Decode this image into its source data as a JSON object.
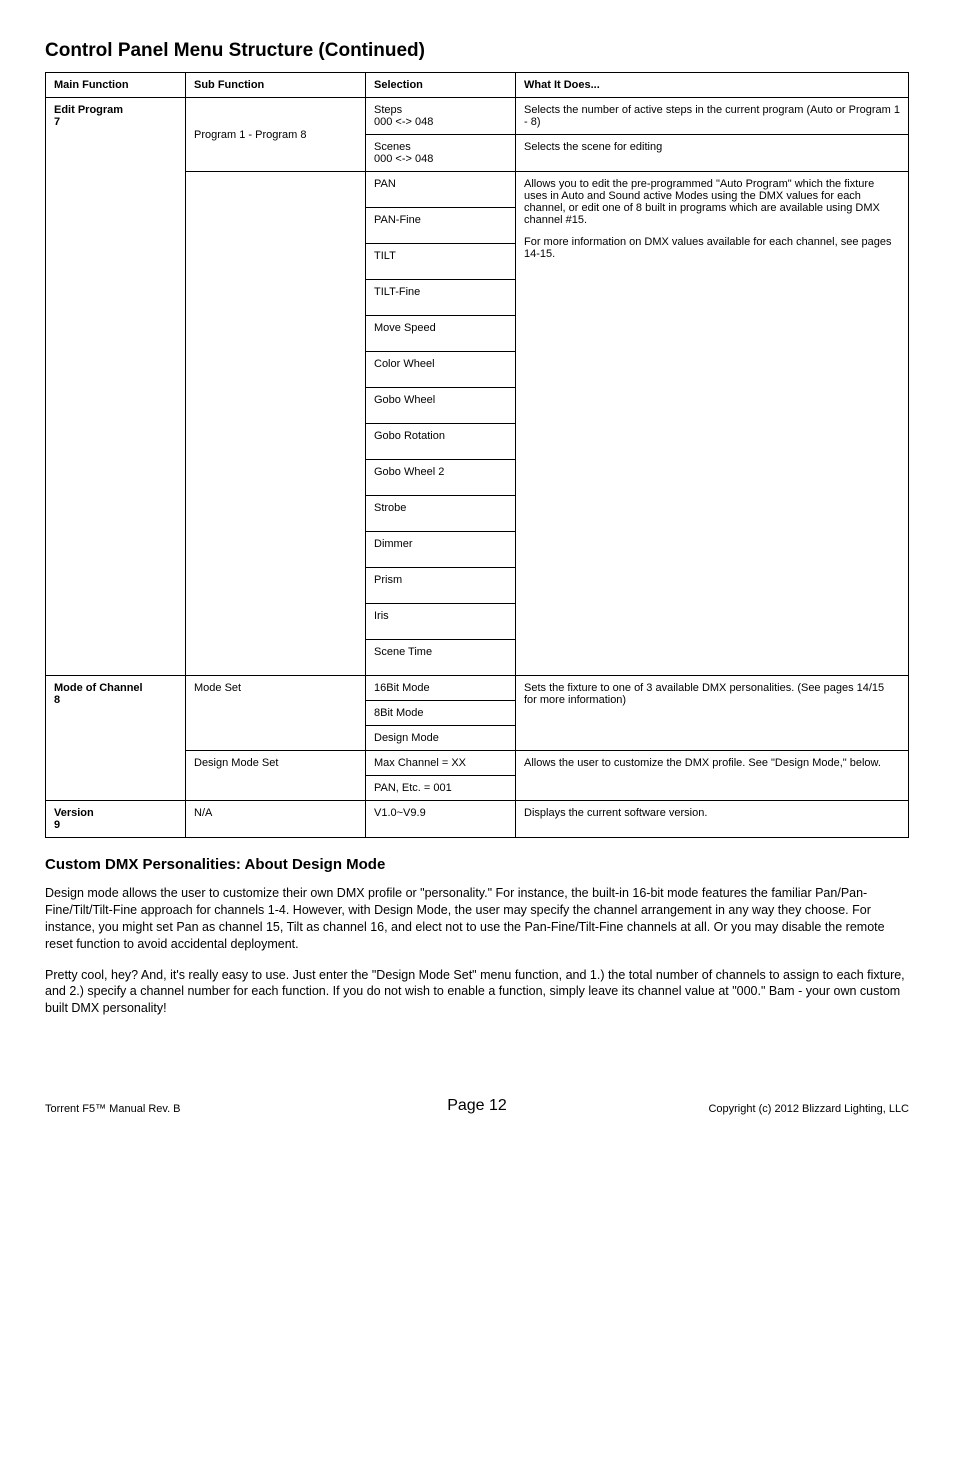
{
  "title": "Control Panel Menu Structure (Continued)",
  "table": {
    "headers": {
      "main": "Main Function",
      "sub": "Sub Function",
      "sel": "Selection",
      "what": "What It Does..."
    },
    "edit_program": {
      "label_l1": "Edit Program",
      "label_l2": "7",
      "sub": "Program 1 - Program 8",
      "steps_sel": "Steps\n000 <-> 048",
      "steps_what": "Selects the number of active steps in the current program (Auto or Program 1 - 8)",
      "scenes_sel": "Scenes\n000 <-> 048",
      "scenes_what": "Selects the scene for editing",
      "params": {
        "pan": "PAN",
        "panfine": "PAN-Fine",
        "tilt": "TILT",
        "tiltfine": "TILT-Fine",
        "move": "Move Speed",
        "color": "Color Wheel",
        "gobo": "Gobo Wheel",
        "goborot": "Gobo Rotation",
        "gobo2": "Gobo Wheel 2",
        "strobe": "Strobe",
        "dimmer": "Dimmer",
        "prism": "Prism",
        "iris": "Iris",
        "scenetime": "Scene Time"
      },
      "params_what_p1": "Allows you to edit the pre-programmed \"Auto Program\" which the fixture uses in Auto and Sound active Modes using the DMX values for each channel, or edit one of 8 built in programs which are available using DMX channel #15.",
      "params_what_p2": "For more information on DMX values available for each channel, see pages 14-15."
    },
    "mode_channel": {
      "label_l1": "Mode of Channel",
      "label_l2": "8",
      "modeset_sub": "Mode Set",
      "sel_16": "16Bit Mode",
      "sel_8": "8Bit Mode",
      "sel_design": "Design Mode",
      "modeset_what": "Sets the fixture to one of 3 available DMX personalities.  (See pages 14/15 for more information)",
      "designset_sub": "Design Mode Set",
      "sel_max": "Max Channel = XX",
      "sel_pan": "PAN, Etc. = 001",
      "designset_what": "Allows the user to customize the DMX profile. See \"Design Mode,\" below."
    },
    "version": {
      "label_l1": "Version",
      "label_l2": "9",
      "sub": "N/A",
      "sel": "V1.0~V9.9",
      "what": "Displays the current software version."
    }
  },
  "custom_dmx": {
    "heading": "Custom DMX Personalities: About Design Mode",
    "p1": "Design mode allows the user to customize their own DMX profile or \"personality.\"  For instance, the built-in 16-bit mode features the familiar Pan/Pan-Fine/Tilt/Tilt-Fine approach for channels 1-4.  However, with Design Mode, the user may specify the channel arrangement in any way they choose.  For instance, you might set Pan as channel 15, Tilt as channel 16, and elect not to use the Pan-Fine/Tilt-Fine channels at all.  Or you may disable the remote reset function to avoid accidental deployment.",
    "p2": "Pretty cool, hey?  And, it's really easy to use.  Just enter the \"Design Mode Set\" menu function, and 1.) the total number of channels to assign to each fixture, and 2.) specify a channel number for each function.  If you do not wish to enable a function, simply leave its channel value at \"000.\"  Bam - your own custom built DMX personality!"
  },
  "footer": {
    "left": "Torrent F5™ Manual Rev. B",
    "page": "Page 12",
    "right": "Copyright (c) 2012 Blizzard Lighting, LLC"
  }
}
